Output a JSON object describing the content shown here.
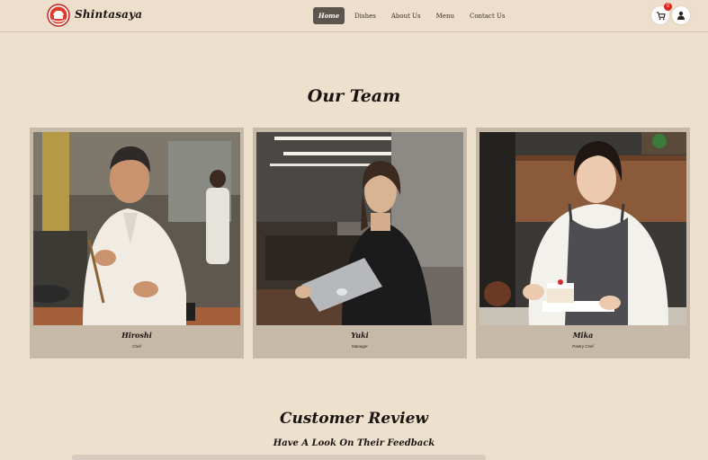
{
  "brand": {
    "name": "Shintasaya",
    "logo_icon": "chef-hat-logo-icon"
  },
  "nav": {
    "items": [
      {
        "label": "Home",
        "active": true
      },
      {
        "label": "Dishes",
        "active": false
      },
      {
        "label": "About Us",
        "active": false
      },
      {
        "label": "Menu",
        "active": false
      },
      {
        "label": "Contact Us",
        "active": false
      }
    ],
    "cart_icon": "cart-icon",
    "cart_badge": "0",
    "user_icon": "user-icon"
  },
  "team": {
    "title": "Our Team",
    "members": [
      {
        "name": "Hiroshi",
        "role": "Chef"
      },
      {
        "name": "Yuki",
        "role": "Manager"
      },
      {
        "name": "Mika",
        "role": "Pastry Chef"
      }
    ]
  },
  "reviews": {
    "title": "Customer Review",
    "subtitle": "Have A Look On Their Feedback"
  },
  "colors": {
    "page_bg": "#ede0cd",
    "card_bg": "#c7b9a7",
    "active_nav_bg": "#5c554d",
    "badge": "#d9251d"
  }
}
